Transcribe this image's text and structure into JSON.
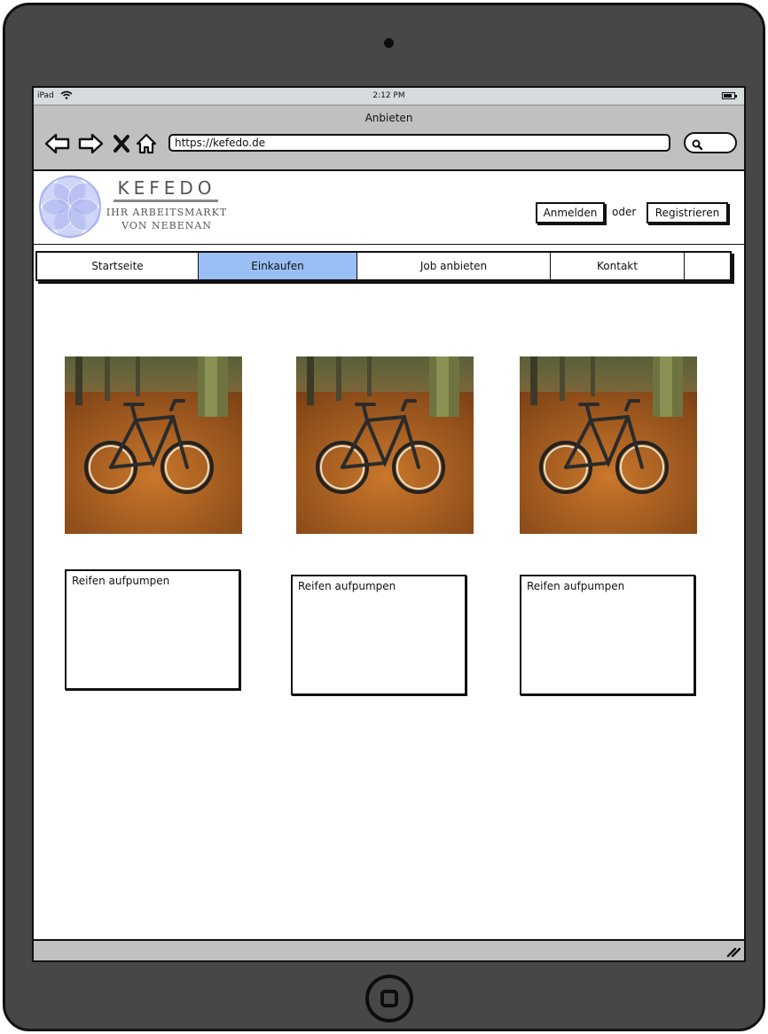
{
  "status_bar": {
    "carrier": "iPad",
    "time": "2:12 PM"
  },
  "browser": {
    "page_title": "Anbieten",
    "url": "https://kefedo.de",
    "nav_icons": [
      "back-arrow-icon",
      "forward-arrow-icon",
      "close-x-icon",
      "home-icon"
    ]
  },
  "brand": {
    "name": "KEFEDO",
    "tagline_line1": "IHR ARBEITSMARKT",
    "tagline_line2": "VON NEBENAN",
    "logo_color": "#a7b3ee"
  },
  "auth": {
    "login_label": "Anmelden",
    "separator": "oder",
    "register_label": "Registrieren"
  },
  "nav": {
    "active_color": "#99bff4",
    "tabs": [
      {
        "label": "Startseite",
        "active": false
      },
      {
        "label": "Einkaufen",
        "active": true
      },
      {
        "label": "Job anbieten",
        "active": false
      },
      {
        "label": "Kontakt",
        "active": false
      },
      {
        "label": "",
        "active": false
      }
    ]
  },
  "products": [
    {
      "image": "mountain-bike-photo",
      "description": "Reifen aufpumpen"
    },
    {
      "image": "mountain-bike-photo",
      "description": "Reifen aufpumpen"
    },
    {
      "image": "mountain-bike-photo",
      "description": "Reifen aufpumpen"
    }
  ]
}
